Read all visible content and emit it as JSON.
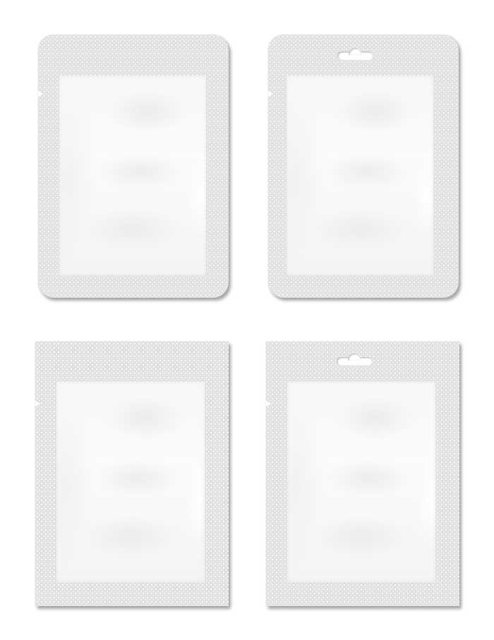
{
  "scene": {
    "background": "#ffffff",
    "pouch_color": "#e9e9e9",
    "window_color": "#f8f8f8"
  },
  "pouches": [
    {
      "shape": "rounded-corners",
      "tear_notch": true,
      "hang_hole": false
    },
    {
      "shape": "rounded-corners",
      "tear_notch": true,
      "hang_hole": true
    },
    {
      "shape": "square-corners",
      "tear_notch": true,
      "hang_hole": false
    },
    {
      "shape": "square-corners",
      "tear_notch": true,
      "hang_hole": true
    }
  ]
}
